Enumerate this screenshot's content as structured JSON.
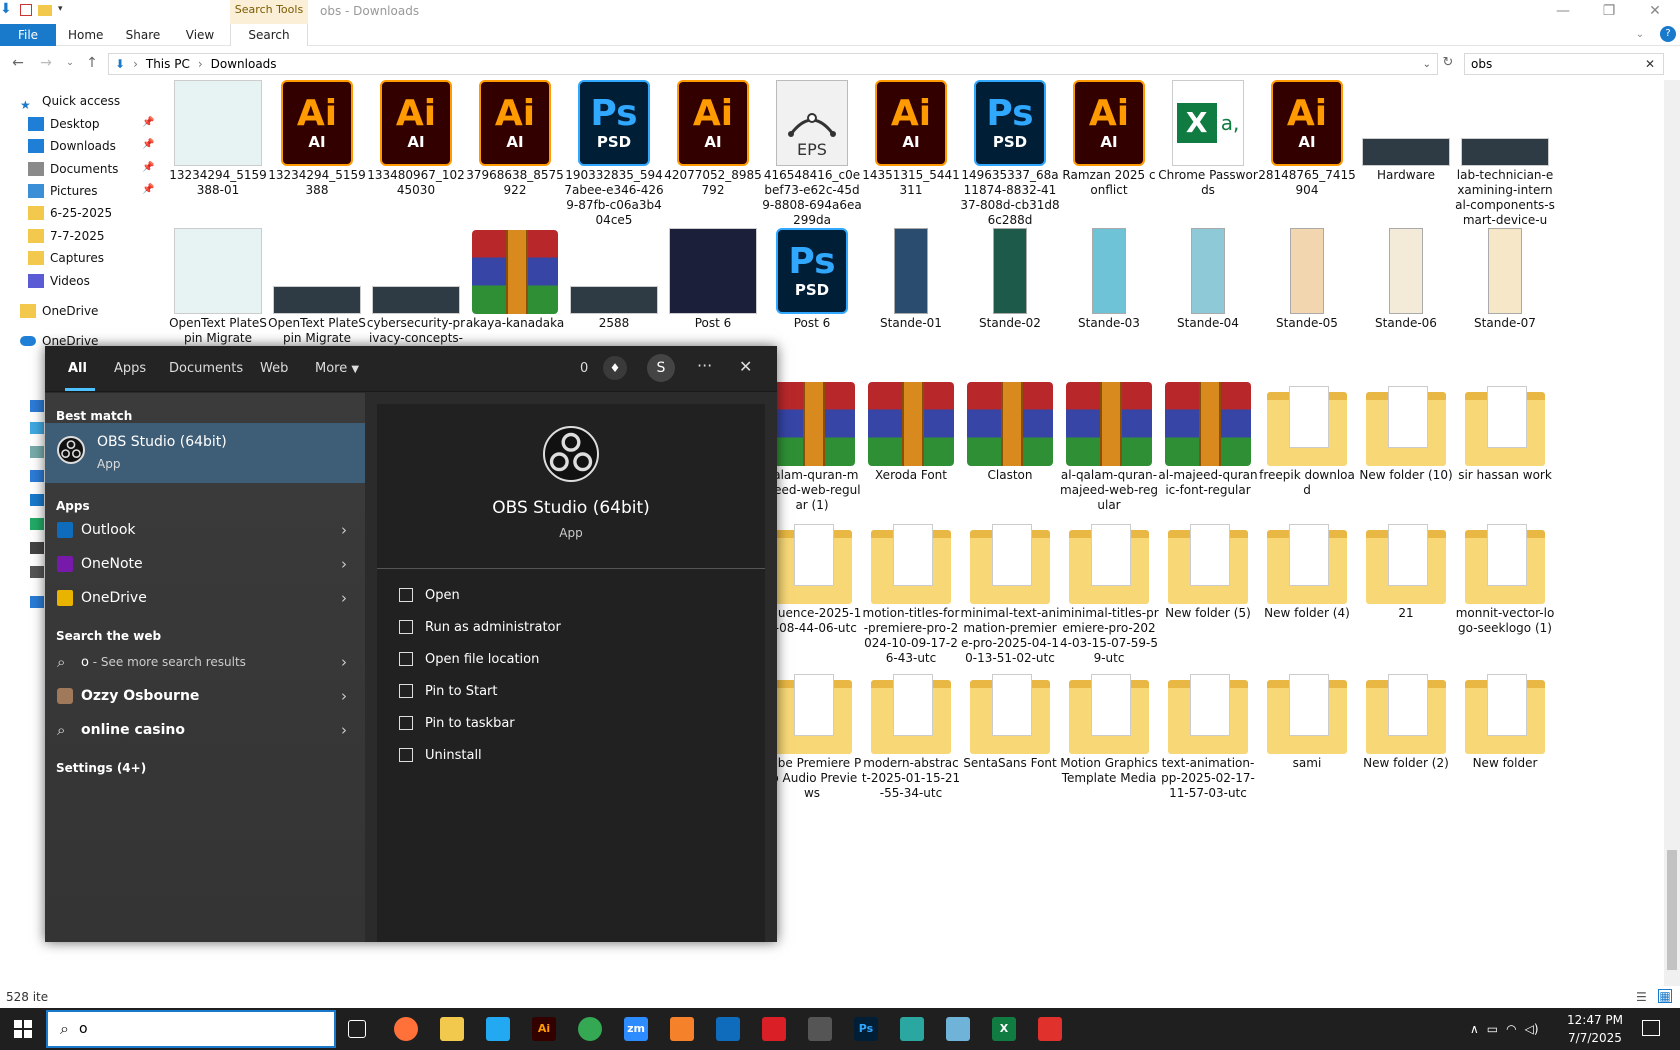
{
  "window": {
    "title": "obs - Downloads",
    "context_tab": "Search Tools"
  },
  "ribbon": {
    "tabs": [
      "File",
      "Home",
      "Share",
      "View",
      "Search"
    ]
  },
  "address": {
    "crumbs": [
      "This PC",
      "Downloads"
    ],
    "search_value": "obs"
  },
  "nav": {
    "items": [
      {
        "label": "Quick access",
        "icon": "star-icon",
        "color": "#1979ca"
      },
      {
        "label": "Desktop",
        "icon": "desktop-icon",
        "color": "#1f7fd6",
        "pinned": true
      },
      {
        "label": "Downloads",
        "icon": "download-icon",
        "color": "#1f7fd6",
        "pinned": true
      },
      {
        "label": "Documents",
        "icon": "documents-icon",
        "color": "#8a8a8a",
        "pinned": true
      },
      {
        "label": "Pictures",
        "icon": "pictures-icon",
        "color": "#3a8fd6",
        "pinned": true
      },
      {
        "label": "6-25-2025",
        "icon": "folder-icon",
        "color": "#f2c94c"
      },
      {
        "label": "7-7-2025",
        "icon": "folder-icon",
        "color": "#f2c94c"
      },
      {
        "label": "Captures",
        "icon": "folder-icon",
        "color": "#f2c94c"
      },
      {
        "label": "Videos",
        "icon": "videos-icon",
        "color": "#5b5bd6"
      },
      {
        "label": "OneDrive",
        "icon": "folder-icon",
        "color": "#f2c94c"
      },
      {
        "label": "OneDrive",
        "icon": "cloud-icon",
        "color": "#1f7fd6"
      }
    ]
  },
  "files": {
    "row1": [
      {
        "name": "13234294_5159388-01",
        "kind": "img"
      },
      {
        "name": "13234294_5159388",
        "kind": "ai"
      },
      {
        "name": "133480967_10245030",
        "kind": "ai"
      },
      {
        "name": "37968638_8575922",
        "kind": "ai"
      },
      {
        "name": "190332835_5947abee-e346-4269-87fb-c06a3b404ce5",
        "kind": "ps"
      },
      {
        "name": "42077052_8985792",
        "kind": "ai"
      },
      {
        "name": "416548416_c0ebef73-e62c-45d9-8808-694a6ea299da",
        "kind": "eps"
      },
      {
        "name": "14351315_5441311",
        "kind": "ai"
      },
      {
        "name": "149635337_68a11874-8832-4137-808d-cb31d86c288d",
        "kind": "ps"
      },
      {
        "name": "Ramzan 2025 conflict",
        "kind": "ai"
      },
      {
        "name": "Chrome Passwords",
        "kind": "xl"
      },
      {
        "name": "28148765_7415904",
        "kind": "ai"
      },
      {
        "name": "Hardware",
        "kind": "img"
      },
      {
        "name": "lab-technician-examining-internal-components-smart-device-us...",
        "kind": "img"
      }
    ],
    "row2": [
      {
        "name": "OpenText PlateSpin Migrate",
        "kind": "img"
      },
      {
        "name": "OpenText PlateSpin Migrate",
        "kind": "img"
      },
      {
        "name": "cybersecurity-privacy-concepts-protect-data-lock",
        "kind": "img"
      },
      {
        "name": "akaya-kanadaka",
        "kind": "rar"
      },
      {
        "name": "2588",
        "kind": "img"
      },
      {
        "name": "Post 6",
        "kind": "poster-dark"
      },
      {
        "name": "Post 6",
        "kind": "ps"
      },
      {
        "name": "Stande-01",
        "kind": "poster"
      },
      {
        "name": "Stande-02",
        "kind": "poster"
      },
      {
        "name": "Stande-03",
        "kind": "poster"
      },
      {
        "name": "Stande-04",
        "kind": "poster"
      },
      {
        "name": "Stande-05",
        "kind": "poster"
      },
      {
        "name": "Stande-06",
        "kind": "poster"
      },
      {
        "name": "Stande-07",
        "kind": "poster"
      }
    ],
    "row3": [
      {
        "name": "qalam-quran-majeed-web-regular (1)",
        "kind": "rar"
      },
      {
        "name": "Xeroda Font",
        "kind": "rar"
      },
      {
        "name": "Claston",
        "kind": "rar"
      },
      {
        "name": "al-qalam-quran-majeed-web-regular",
        "kind": "rar"
      },
      {
        "name": "al-majeed-quranic-font-regular",
        "kind": "rar"
      },
      {
        "name": "freepik download",
        "kind": "folder"
      },
      {
        "name": "New folder (10)",
        "kind": "folder"
      },
      {
        "name": "sir hassan work",
        "kind": "folder"
      }
    ],
    "row4": [
      {
        "name": "nfluence-2025-16-08-44-06-utc",
        "kind": "folder"
      },
      {
        "name": "motion-titles-for-premiere-pro-2024-10-09-17-26-43-utc",
        "kind": "folder"
      },
      {
        "name": "minimal-text-animation-premiere-pro-2025-04-10-13-51-02-utc",
        "kind": "folder"
      },
      {
        "name": "minimal-titles-premiere-pro-2024-03-15-07-59-59-utc",
        "kind": "folder"
      },
      {
        "name": "New folder (5)",
        "kind": "folder"
      },
      {
        "name": "New folder (4)",
        "kind": "folder"
      },
      {
        "name": "21",
        "kind": "folder"
      },
      {
        "name": "monnit-vector-logo-seeklogo (1)",
        "kind": "folder"
      }
    ],
    "row5": [
      {
        "name": "dobe Premiere Pro Audio Previews",
        "kind": "folder"
      },
      {
        "name": "modern-abstract-2025-01-15-21-55-34-utc",
        "kind": "folder"
      },
      {
        "name": "SentaSans Font",
        "kind": "folder"
      },
      {
        "name": "Motion Graphics Template Media",
        "kind": "folder"
      },
      {
        "name": "text-animation-pp-2025-02-17-11-57-03-utc",
        "kind": "folder"
      },
      {
        "name": "sami",
        "kind": "folder"
      },
      {
        "name": "New folder (2)",
        "kind": "folder"
      },
      {
        "name": "New folder",
        "kind": "folder"
      }
    ]
  },
  "status": {
    "items_count": "528 ite"
  },
  "start_menu": {
    "tabs": [
      "All",
      "Apps",
      "Documents",
      "Web",
      "More"
    ],
    "points": "0",
    "avatar_letter": "S",
    "best_match_title": "Best match",
    "best_match": {
      "name": "OBS Studio (64bit)",
      "type": "App"
    },
    "apps_title": "Apps",
    "apps": [
      {
        "label": "Outlook",
        "icon": "outlook-icon",
        "color": "#0f6cbd"
      },
      {
        "label": "OneNote",
        "icon": "onenote-icon",
        "color": "#7719aa"
      },
      {
        "label": "OneDrive",
        "icon": "onedrive-file-icon",
        "color": "#e8b400"
      }
    ],
    "web_title": "Search the web",
    "web": [
      {
        "label": "o",
        "suffix": " - See more search results",
        "icon": "search-icon"
      },
      {
        "label": "Ozzy Osbourne",
        "icon": "person-icon"
      },
      {
        "label": "online casino",
        "icon": "search-icon"
      }
    ],
    "settings_label": "Settings (4+)",
    "preview": {
      "name": "OBS Studio (64bit)",
      "type": "App"
    },
    "actions": [
      {
        "label": "Open",
        "icon": "open-icon"
      },
      {
        "label": "Run as administrator",
        "icon": "shield-icon"
      },
      {
        "label": "Open file location",
        "icon": "file-location-icon"
      },
      {
        "label": "Pin to Start",
        "icon": "pin-icon"
      },
      {
        "label": "Pin to taskbar",
        "icon": "pin-icon"
      },
      {
        "label": "Uninstall",
        "icon": "trash-icon"
      }
    ]
  },
  "taskbar": {
    "search_value": "o",
    "apps": [
      {
        "name": "task-view",
        "label": "",
        "color": "#1f1f1f"
      },
      {
        "name": "firefox",
        "label": "",
        "color": "#ff7139"
      },
      {
        "name": "file-explorer",
        "label": "",
        "color": "#f2c94c"
      },
      {
        "name": "vscode",
        "label": "",
        "color": "#23a9f2"
      },
      {
        "name": "illustrator",
        "label": "Ai",
        "color": "#330000"
      },
      {
        "name": "chrome",
        "label": "",
        "color": "#34a853"
      },
      {
        "name": "zoom",
        "label": "zm",
        "color": "#2d8cff"
      },
      {
        "name": "app-orange",
        "label": "",
        "color": "#f5822a"
      },
      {
        "name": "outlook",
        "label": "",
        "color": "#0f6cbd"
      },
      {
        "name": "creative-cloud",
        "label": "",
        "color": "#da1f26"
      },
      {
        "name": "pen-tool",
        "label": "",
        "color": "#555555"
      },
      {
        "name": "photoshop",
        "label": "Ps",
        "color": "#001e36"
      },
      {
        "name": "app-teal",
        "label": "",
        "color": "#2aa7a0"
      },
      {
        "name": "app-notes",
        "label": "",
        "color": "#6fb3d8"
      },
      {
        "name": "excel",
        "label": "X",
        "color": "#107c41"
      },
      {
        "name": "app-snip",
        "label": "",
        "color": "#e0312d"
      }
    ],
    "time": "12:47 PM",
    "date": "7/7/2025"
  }
}
